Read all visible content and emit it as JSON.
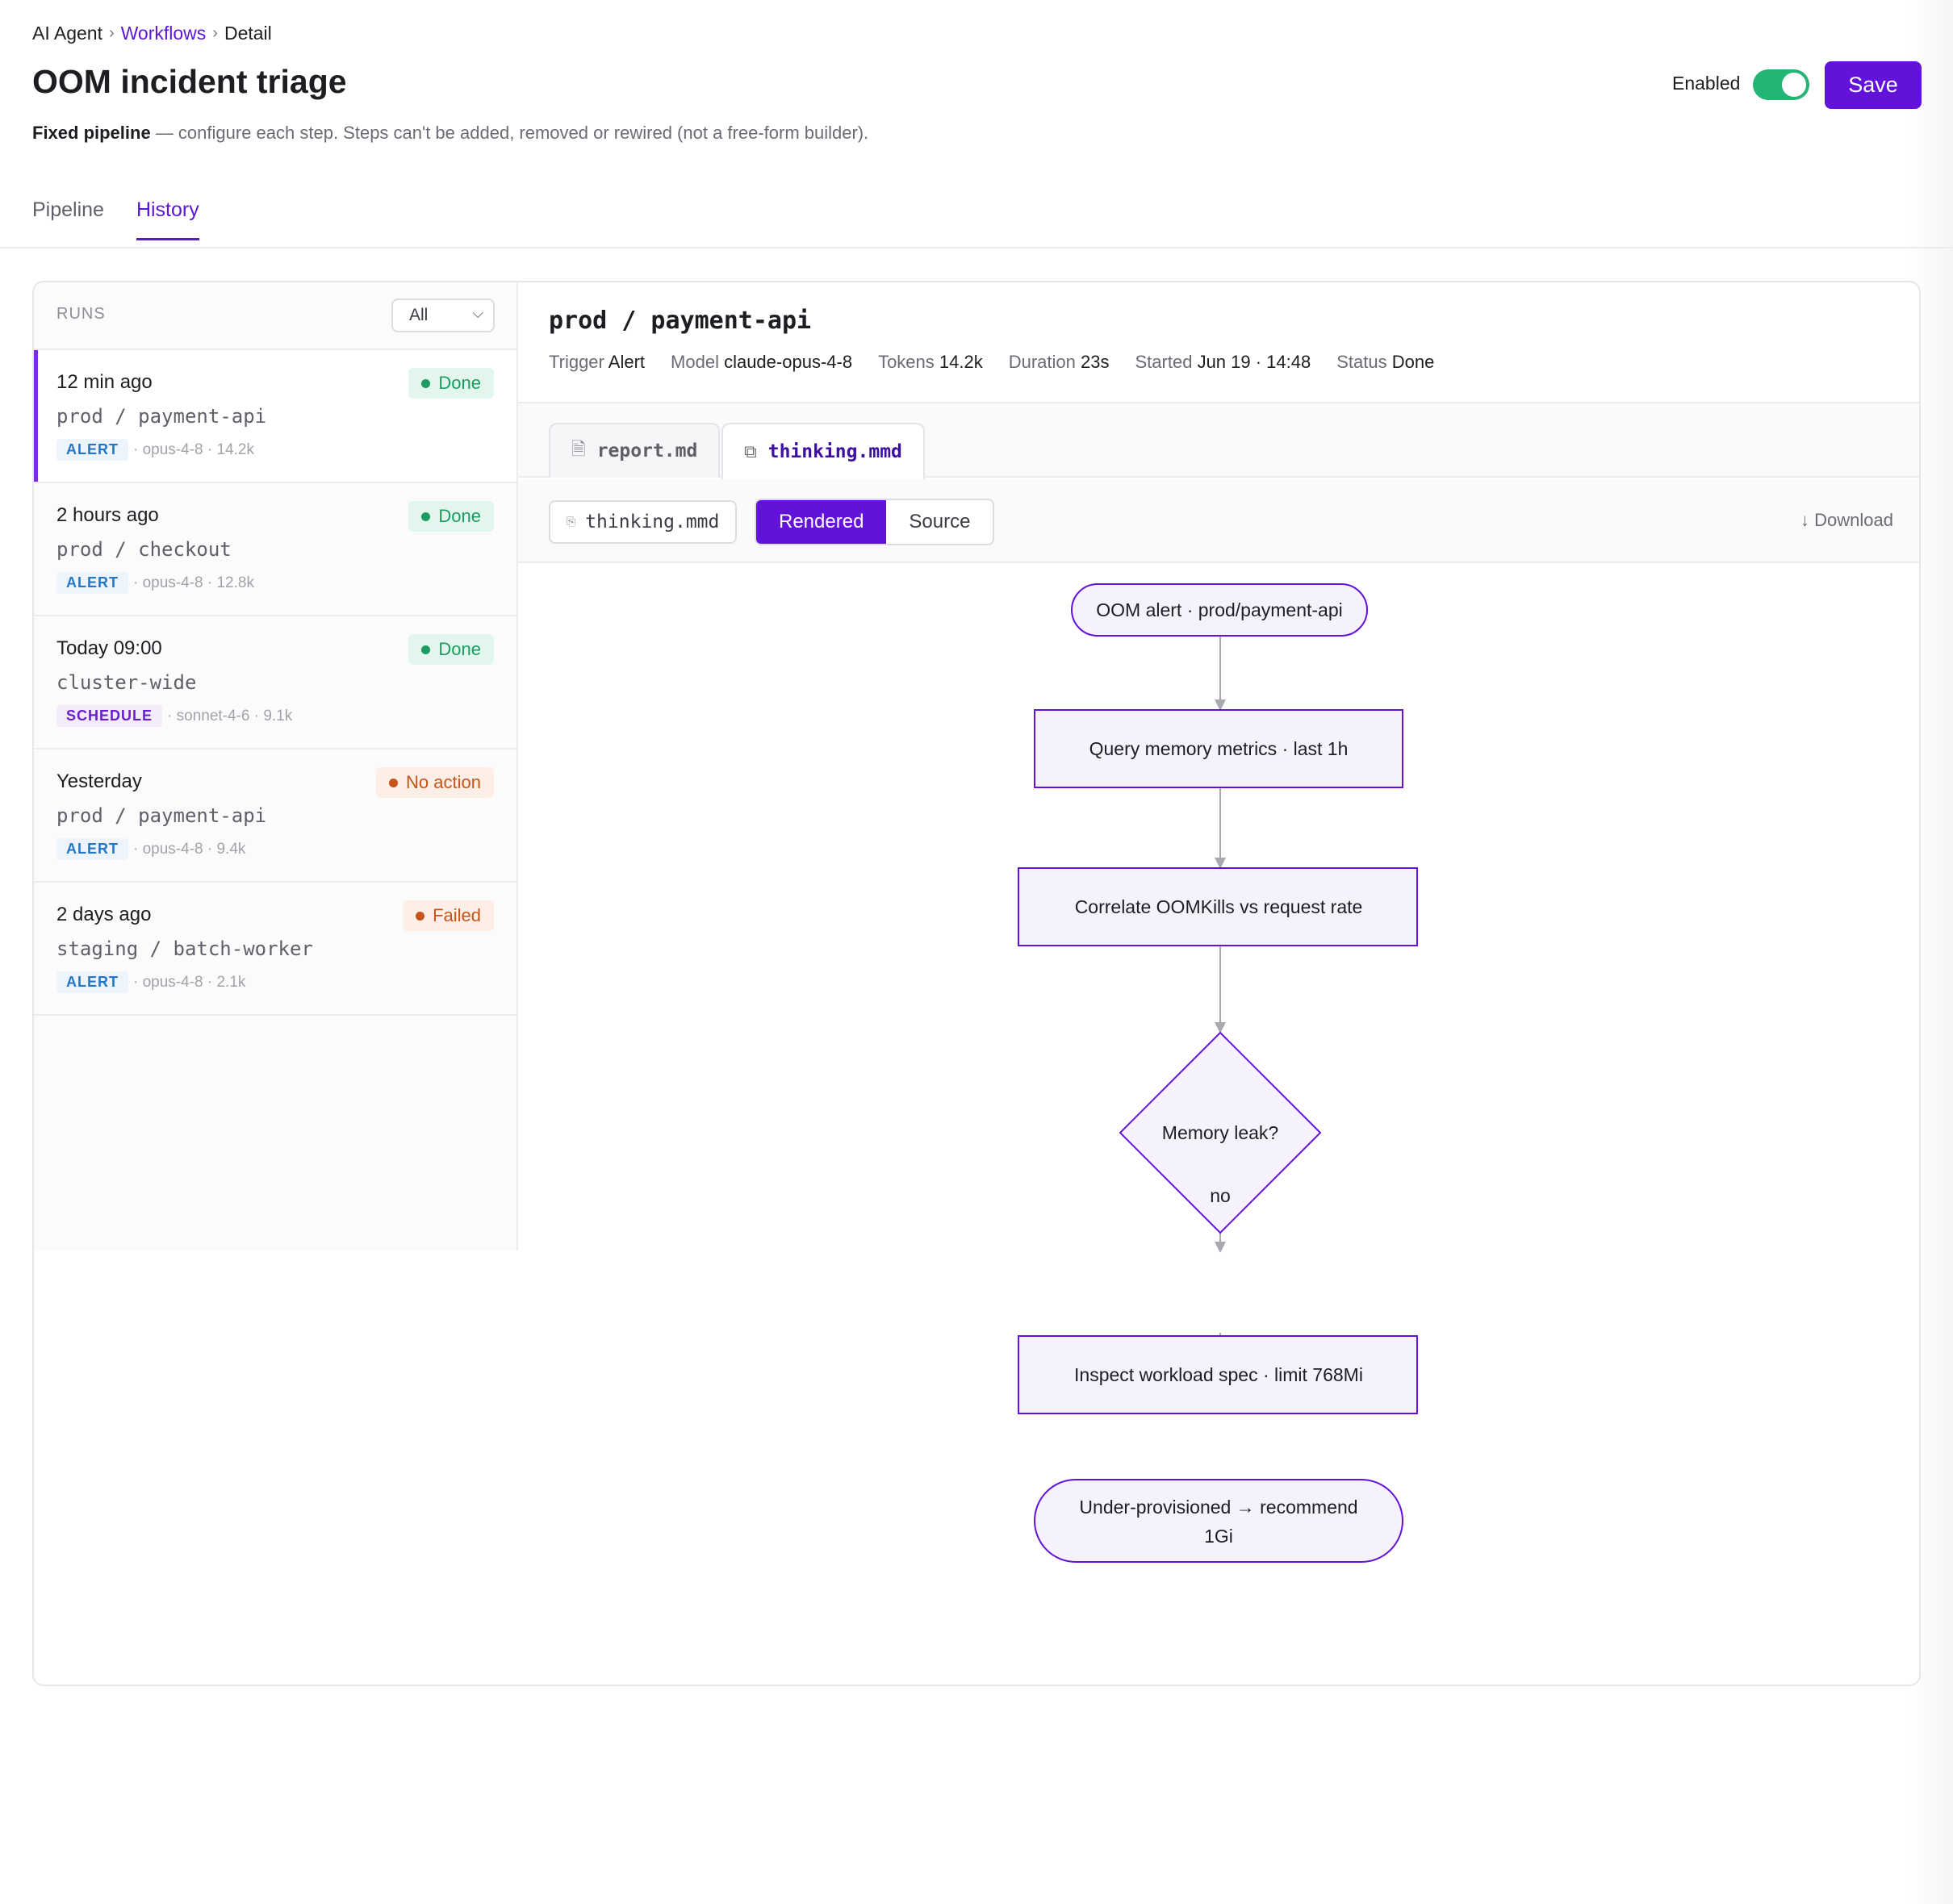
{
  "breadcrumb": {
    "root": "AI Agent",
    "sep1": "›",
    "section": "Workflows",
    "sep2": "›",
    "current": "Detail"
  },
  "header": {
    "title": "OOM incident triage",
    "subtitle_bold": "Fixed pipeline",
    "subtitle_rest": " — configure each step. Steps can't be added, removed or rewired (not a free-form builder).",
    "enabled_label": "Enabled",
    "enabled": true,
    "save_label": "Save"
  },
  "tabs": [
    {
      "label": "Pipeline",
      "active": false
    },
    {
      "label": "History",
      "active": true
    }
  ],
  "runs": {
    "title": "RUNS",
    "filter": "All",
    "items": [
      {
        "time": "12 min ago",
        "target": "prod / payment-api",
        "trigger": "ALERT",
        "meta": "· opus-4-8 · 14.2k",
        "status": "Done",
        "status_kind": "done"
      },
      {
        "time": "2 hours ago",
        "target": "prod / checkout",
        "trigger": "ALERT",
        "meta": "· opus-4-8 · 12.8k",
        "status": "Done",
        "status_kind": "done"
      },
      {
        "time": "Today 09:00",
        "target": "cluster-wide",
        "trigger": "SCHEDULE",
        "meta": "· sonnet-4-6 · 9.1k",
        "status": "Done",
        "status_kind": "done"
      },
      {
        "time": "Yesterday",
        "target": "prod / payment-api",
        "trigger": "ALERT",
        "meta": "· opus-4-8 · 9.4k",
        "status": "No action",
        "status_kind": "noaction"
      },
      {
        "time": "2 days ago",
        "target": "staging / batch-worker",
        "trigger": "ALERT",
        "meta": "· opus-4-8 · 2.1k",
        "status": "Failed",
        "status_kind": "failed"
      }
    ]
  },
  "detail": {
    "title": "prod / payment-api",
    "meta": {
      "trigger_k": "Trigger",
      "trigger_v": "Alert",
      "model_k": "Model",
      "model_v": "claude-opus-4-8",
      "tokens_k": "Tokens",
      "tokens_v": "14.2k",
      "duration_k": "Duration",
      "duration_v": "23s",
      "started_k": "Started",
      "started_v": "Jun 19 · 14:48",
      "status_k": "Status",
      "status_v": "Done"
    },
    "file_tabs": [
      {
        "label": "report.md",
        "icon": "document-icon",
        "active": false
      },
      {
        "label": "thinking.mmd",
        "icon": "flowchart-icon",
        "active": true
      }
    ],
    "file_chip": "thinking.mmd",
    "view_modes": {
      "rendered": "Rendered",
      "source": "Source",
      "active": "Rendered"
    },
    "download_label": "↓ Download"
  },
  "flowchart": {
    "start": "OOM alert · prod/payment-api",
    "step1": "Query memory metrics · last 1h",
    "step2": "Correlate OOMKills vs request rate",
    "decision": "Memory leak?",
    "edge_label": "no",
    "step3": "Inspect workload spec · limit 768Mi",
    "end_line1": "Under-provisioned → recommend",
    "end_line2": "1Gi"
  },
  "colors": {
    "accent": "#6312d9",
    "toggle_on": "#22b573",
    "node_fill": "#f5f2fe",
    "node_stroke": "#6312d9",
    "edge": "#a8a8b0"
  }
}
